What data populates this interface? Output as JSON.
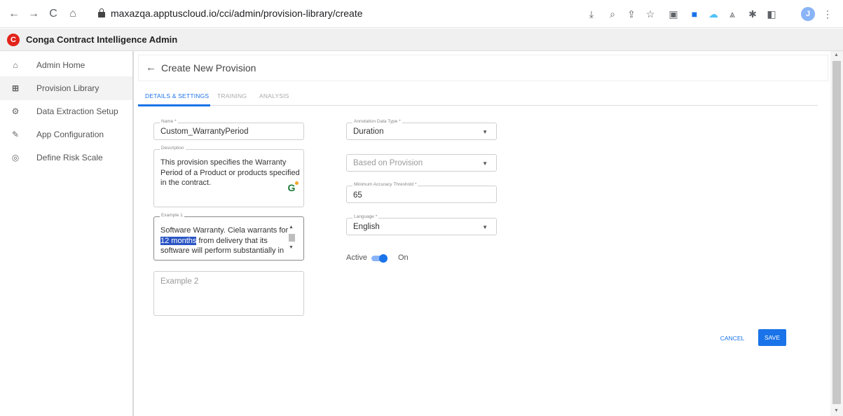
{
  "browser": {
    "url": "maxazqa.apptuscloud.io/cci/admin/provision-library/create",
    "back_icon": "←",
    "forward_icon": "→",
    "reload_icon": "C",
    "home_icon": "⌂",
    "avatar_letter": "J"
  },
  "app": {
    "logo_letter": "C",
    "title": "Conga Contract Intelligence Admin",
    "accent_color": "#1a73e8",
    "brand_color": "#e2231a"
  },
  "sidebar": {
    "items": [
      {
        "label": "Admin Home",
        "icon": "home-icon"
      },
      {
        "label": "Provision Library",
        "icon": "library-icon"
      },
      {
        "label": "Data Extraction Setup",
        "icon": "extraction-gear-icon"
      },
      {
        "label": "App Configuration",
        "icon": "wrench-icon"
      },
      {
        "label": "Define Risk Scale",
        "icon": "risk-scale-icon"
      }
    ],
    "active_index": 1
  },
  "page": {
    "title": "Create New Provision",
    "tabs": [
      {
        "label": "DETAILS & SETTINGS"
      },
      {
        "label": "TRAINING"
      },
      {
        "label": "ANALYSIS"
      }
    ],
    "active_tab": 0
  },
  "form": {
    "name": {
      "label": "Name *",
      "value": "Custom_WarrantyPeriod"
    },
    "description": {
      "label": "Description",
      "value": "This provision specifies the Warranty Period of a Product or products specified in the contract."
    },
    "example1": {
      "label": "Example 1",
      "before": "Software Warranty. Ciela warrants for ",
      "highlight": "12 months",
      "after": " from delivery that its software will perform substantially in"
    },
    "example2": {
      "placeholder": "Example 2"
    },
    "annotation_type": {
      "label": "Annotation Data Type *",
      "value": "Duration"
    },
    "based_on": {
      "placeholder": "Based on Provision"
    },
    "threshold": {
      "label": "Minimum Accuracy Threshold *",
      "value": "65"
    },
    "language": {
      "label": "Language *",
      "value": "English"
    },
    "active": {
      "label": "Active",
      "state": "On",
      "on": true
    }
  },
  "actions": {
    "cancel": "CANCEL",
    "save": "SAVE"
  }
}
